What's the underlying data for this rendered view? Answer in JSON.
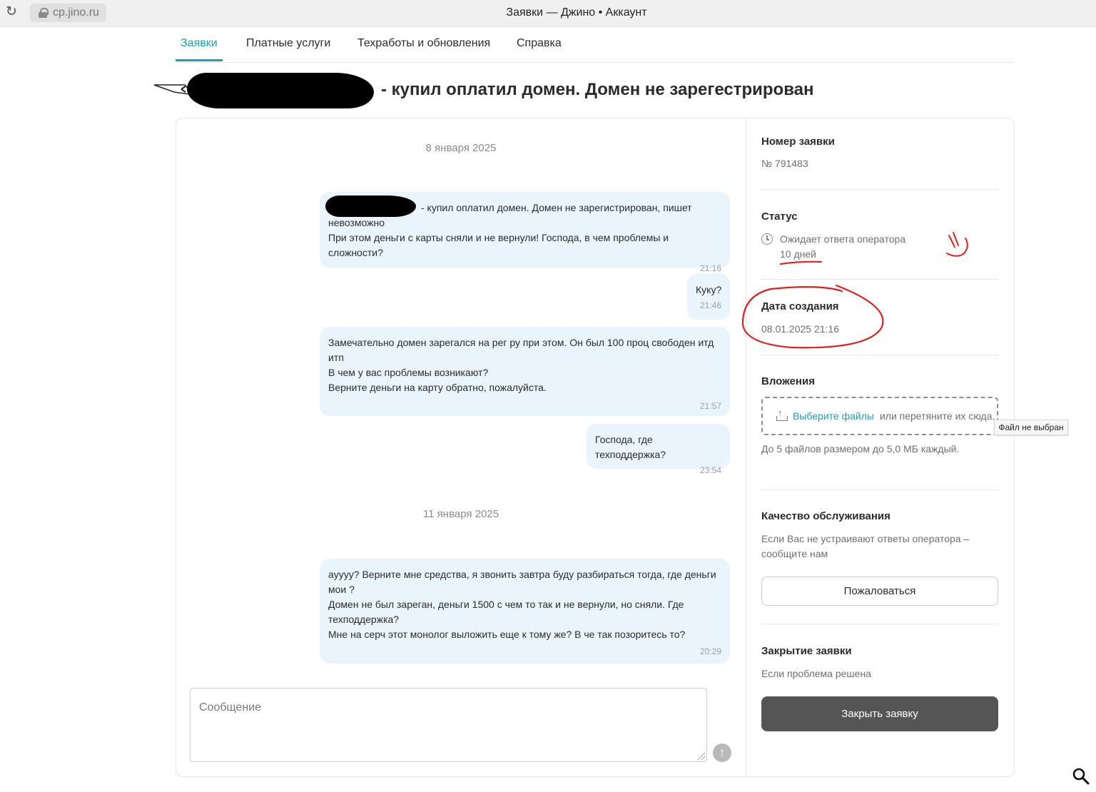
{
  "browser": {
    "url": "cp.jino.ru",
    "window_title": "Заявки — Джино • Аккаунт"
  },
  "nav": {
    "tabs": [
      "Заявки",
      "Платные услуги",
      "Техработы и обновления",
      "Справка"
    ]
  },
  "ticket": {
    "title": "- купил оплатил домен. Домен не зарегестрирован"
  },
  "chat": {
    "dates": [
      "8 января 2025",
      "11 января 2025"
    ],
    "messages": [
      {
        "text": "- купил оплатил домен. Домен не зарегистрирован, пишет\nневозможно\nПри этом деньги с карты сняли и не вернули! Господа, в чем проблемы и сложности?",
        "time": "21:16"
      },
      {
        "text": "Куку?",
        "time": "21:46"
      },
      {
        "text": "Замечательно домен зарегался на рег ру при этом. Он был 100 проц свободен итд\nитп\nВ чем у вас проблемы возникают?\nВерните деньги на карту обратно, пожалуйста.",
        "time": "21:57"
      },
      {
        "text": "Господа, где техподдержка?",
        "time": "23:54"
      },
      {
        "text": "ayyyy? Верните мне средства, я звонить завтра буду разбираться тогда, где деньги\nмои ?\nДомен не был зареган, деньги 1500 с чем то так и не вернули, но сняли. Где\nтехподдержка?\nМне на серч этот монолог выложить еще к тому же? В че так позоритесь то?",
        "time": "20:29"
      }
    ],
    "compose_placeholder": "Сообщение"
  },
  "sidebar": {
    "number_heading": "Номер заявки",
    "number_value": "№ 791483",
    "status_heading": "Статус",
    "status_value": "Ожидает ответа оператора",
    "status_age": "10 дней",
    "created_heading": "Дата создания",
    "created_value": "08.01.2025 21:16",
    "attachments_heading": "Вложения",
    "attach_link": "Выберите файлы",
    "attach_rest": "или перетяните их сюда.",
    "attach_tooltip": "Файл не выбран",
    "attach_limit": "До 5 файлов размером до 5,0 МБ каждый.",
    "quality_heading": "Качество обслуживания",
    "quality_text": "Если Вас не устраивают ответы оператора –\nсообщите нам",
    "complain_button": "Пожаловаться",
    "close_heading": "Закрытие заявки",
    "close_text": "Если проблема решена",
    "close_button": "Закрыть заявку"
  },
  "colors": {
    "accent": "#1aa0b6",
    "bubble": "#e9f4fd",
    "dark_button": "#555555",
    "annotation": "#e02020"
  }
}
